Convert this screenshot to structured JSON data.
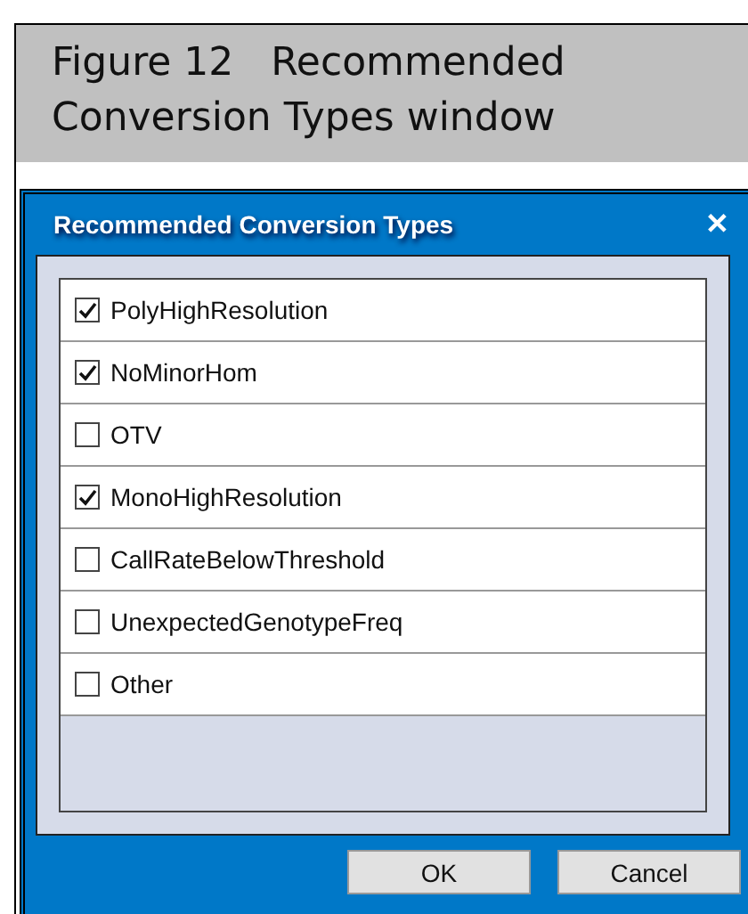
{
  "caption": {
    "label": "Figure 12",
    "title": "Recommended Conversion Types window"
  },
  "window": {
    "title": "Recommended Conversion Types",
    "close": "✕"
  },
  "items": [
    {
      "label": "PolyHighResolution",
      "checked": true
    },
    {
      "label": "NoMinorHom",
      "checked": true
    },
    {
      "label": "OTV",
      "checked": false
    },
    {
      "label": "MonoHighResolution",
      "checked": true
    },
    {
      "label": "CallRateBelowThreshold",
      "checked": false
    },
    {
      "label": "UnexpectedGenotypeFreq",
      "checked": false
    },
    {
      "label": "Other",
      "checked": false
    }
  ],
  "buttons": [
    "OK",
    "Cancel"
  ]
}
